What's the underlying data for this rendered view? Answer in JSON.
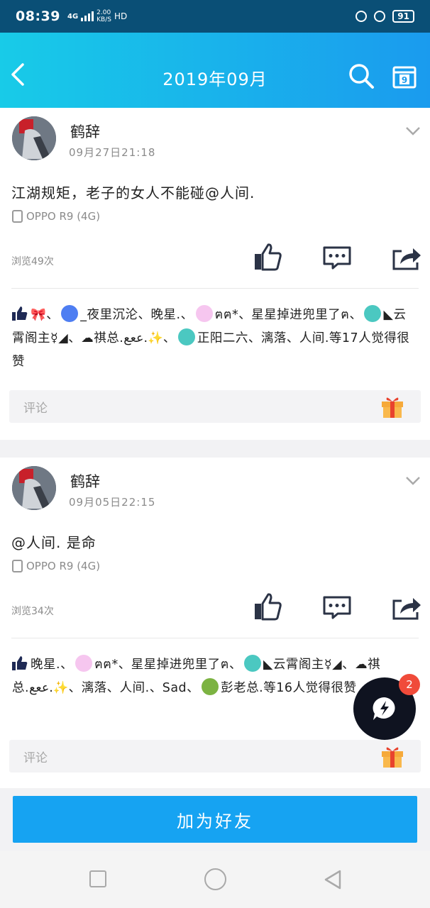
{
  "status_bar": {
    "time": "08:39",
    "network": "4G",
    "speed_value": "2.00",
    "speed_unit": "KB/S",
    "hd": "HD",
    "battery": "91"
  },
  "header": {
    "title": "2019年09月",
    "calendar_day": "9"
  },
  "posts": [
    {
      "author": "鹤辞",
      "time": "09月27日21:18",
      "content": "江湖规矩，老子的女人不能碰@人间.",
      "device": "OPPO R9 (4G)",
      "views": "浏览49次",
      "likes": {
        "n1": "、",
        "n2": "_夜里沉沦、晚星.、",
        "n3": "ฅฅ*、星星掉进兜里了ฅ、",
        "n4": "◣云霄阁主☿◢、",
        "n5": "祺总.ععع.",
        "n6": "✨、",
        "n7": "正阳二六、漓落、人间.",
        "summary": "等17人觉得很赞"
      },
      "comment_placeholder": "评论"
    },
    {
      "author": "鹤辞",
      "time": "09月05日22:15",
      "content": "@人间. 是命",
      "device": "OPPO R9 (4G)",
      "views": "浏览34次",
      "likes": {
        "n1": "晚星.、",
        "n2": "ฅฅ*、星星掉进兜里了ฅ、",
        "n3": "◣云霄阁主☿◢、",
        "n4": "祺总.ععع.",
        "n5": "✨、漓落、人间.、Sad、",
        "n6": "彭老总.",
        "summary": "等16人觉得很赞"
      },
      "comment_placeholder": "评论"
    }
  ],
  "add_friend_label": "加为好友",
  "float_badge": "2",
  "colors": {
    "header_start": "#18cbe8",
    "header_end": "#1a9bee",
    "button": "#16a3f2",
    "badge": "#f04b3a"
  }
}
